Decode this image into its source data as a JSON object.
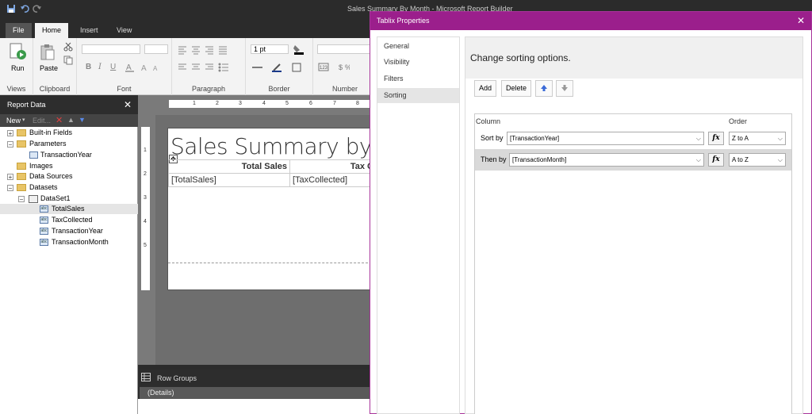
{
  "app": {
    "title": "Sales Summary By Month - Microsoft Report Builder"
  },
  "ribbon": {
    "tabs": {
      "file": "File",
      "home": "Home",
      "insert": "Insert",
      "view": "View"
    },
    "groups": {
      "views": "Views",
      "clipboard": "Clipboard",
      "font": "Font",
      "paragraph": "Paragraph",
      "border": "Border",
      "number": "Number"
    },
    "run_label": "Run",
    "paste_label": "Paste",
    "border_width": "1 pt",
    "bold": "B",
    "italic": "I",
    "underline": "U"
  },
  "report_data": {
    "title": "Report Data",
    "toolbar": {
      "new": "New",
      "edit": "Edit..."
    },
    "tree": {
      "built_in_fields": "Built-in Fields",
      "parameters": "Parameters",
      "transaction_year_param": "TransactionYear",
      "images": "Images",
      "data_sources": "Data Sources",
      "datasets": "Datasets",
      "dataset1": "DataSet1",
      "fields": [
        "TotalSales",
        "TaxCollected",
        "TransactionYear",
        "TransactionMonth"
      ]
    }
  },
  "design": {
    "ruler_numbers": [
      "1",
      "2",
      "3",
      "4",
      "5",
      "6",
      "7",
      "8"
    ],
    "ruler_left_numbers": [
      "1",
      "2",
      "3",
      "4",
      "5"
    ],
    "report_title": "Sales Summary by M",
    "headers": {
      "total_sales": "Total Sales",
      "tax": "Tax C"
    },
    "cells": {
      "total_sales": "[TotalSales]",
      "tax": "[TaxCollected]"
    },
    "row_groups_label": "Row Groups",
    "details_label": "(Details)"
  },
  "dialog": {
    "title": "Tablix Properties",
    "nav": [
      "General",
      "Visibility",
      "Filters",
      "Sorting"
    ],
    "active_nav": "Sorting",
    "heading": "Change sorting options.",
    "buttons": {
      "add": "Add",
      "delete": "Delete"
    },
    "columns": {
      "column": "Column",
      "order": "Order"
    },
    "rows": [
      {
        "label": "Sort by",
        "field": "[TransactionYear]",
        "order": "Z to A"
      },
      {
        "label": "Then by",
        "field": "[TransactionMonth]",
        "order": "A to Z"
      }
    ],
    "fx_label": "fx"
  },
  "colors": {
    "dialog_accent": "#9b1f8c",
    "dark_chrome": "#2b2b2b"
  }
}
